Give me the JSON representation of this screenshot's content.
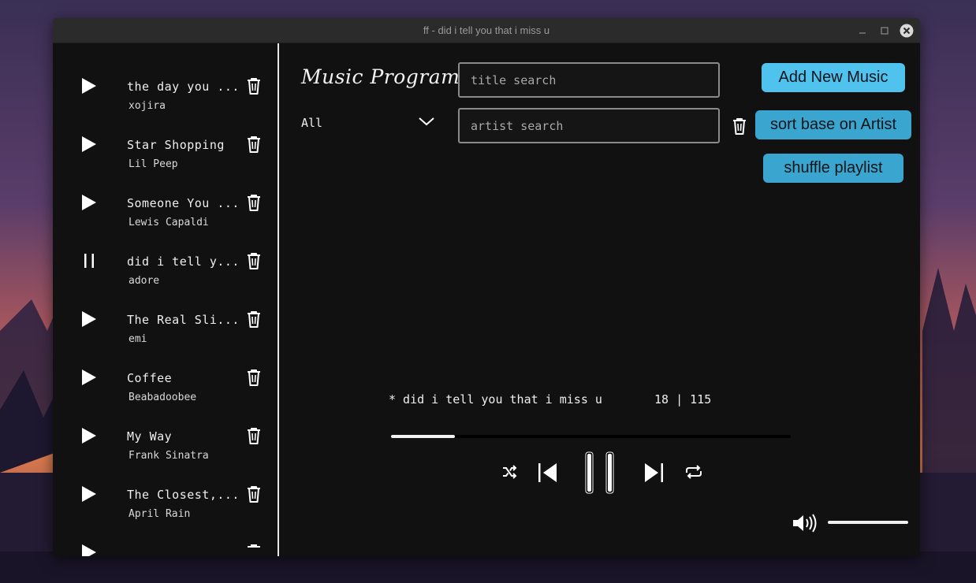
{
  "window": {
    "title": "ff - did i tell you that i miss u"
  },
  "app": {
    "title": "Music Program"
  },
  "search": {
    "title_placeholder": "title search",
    "title_value": "",
    "artist_placeholder": "artist search",
    "artist_value": ""
  },
  "filter": {
    "selected": "All"
  },
  "buttons": {
    "add": "Add New Music",
    "sort": "sort base on Artist",
    "shuffle": "shuffle playlist"
  },
  "playlist": [
    {
      "title": "the day you ...",
      "artist": "xojira",
      "state": "play"
    },
    {
      "title": "Star Shopping",
      "artist": "Lil Peep",
      "state": "play"
    },
    {
      "title": "Someone You ...",
      "artist": "Lewis Capaldi",
      "state": "play"
    },
    {
      "title": "did i tell y...",
      "artist": "adore",
      "state": "pause"
    },
    {
      "title": "The Real Sli...",
      "artist": "emi",
      "state": "play"
    },
    {
      "title": "Coffee",
      "artist": "Beabadoobee",
      "state": "play"
    },
    {
      "title": "My Way",
      "artist": "Frank Sinatra",
      "state": "play"
    },
    {
      "title": "The Closest,...",
      "artist": "April Rain",
      "state": "play"
    }
  ],
  "player": {
    "now_playing": "* did i tell you that i miss u",
    "counter": "18 | 115",
    "progress": 0.16,
    "volume": 1.0
  },
  "colors": {
    "accent_add": "#4fc2ee",
    "accent_buttons": "#3aa6d0",
    "window_bg": "#111111",
    "titlebar_bg": "#2b2b2b",
    "text": "#efefef"
  },
  "icons": {
    "close": "close-icon",
    "minimize": "minimize-icon",
    "maximize": "maximize-icon",
    "play": "play-icon",
    "pause": "pause-icon",
    "delete": "trash-icon",
    "shuffle": "shuffle-icon",
    "previous": "skip-previous-icon",
    "next": "skip-next-icon",
    "repeat": "repeat-icon",
    "volume": "volume-icon",
    "dropdown": "chevron-down-icon"
  }
}
